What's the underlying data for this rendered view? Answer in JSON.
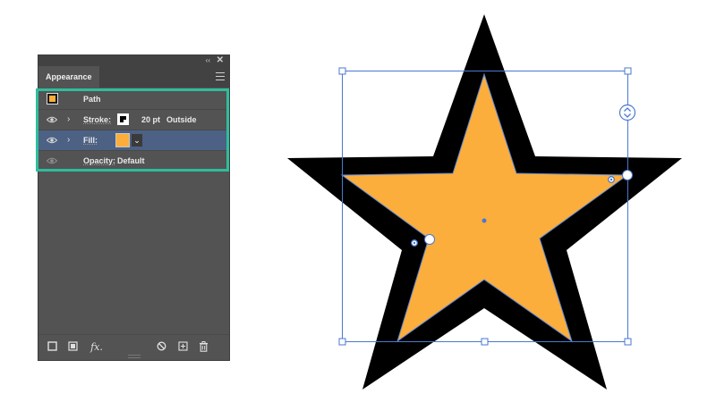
{
  "panel": {
    "tab_label": "Appearance",
    "collapse_glyph": "‹‹",
    "close_glyph": "✕",
    "object": {
      "label": "Path",
      "thumbnail_icon": "path-thumbnail-icon"
    },
    "stroke": {
      "label": "Stroke:",
      "weight": "20 pt",
      "align": "Outside",
      "color": "#000000"
    },
    "fill": {
      "label": "Fill:",
      "color": "#FBAE3B",
      "dropdown_glyph": "⌄"
    },
    "opacity": {
      "label": "Opacity:",
      "value": "Default"
    },
    "bottom_icons": [
      "add-new-stroke-icon",
      "add-new-fill-icon",
      "add-effect-icon",
      "clear-appearance-icon",
      "duplicate-item-icon",
      "delete-item-icon"
    ],
    "fx_label": "fx."
  },
  "colors": {
    "star_fill": "#FBAE3B",
    "star_stroke": "#000000",
    "selection": "#4a78d0",
    "highlight": "#2fbd9d"
  }
}
